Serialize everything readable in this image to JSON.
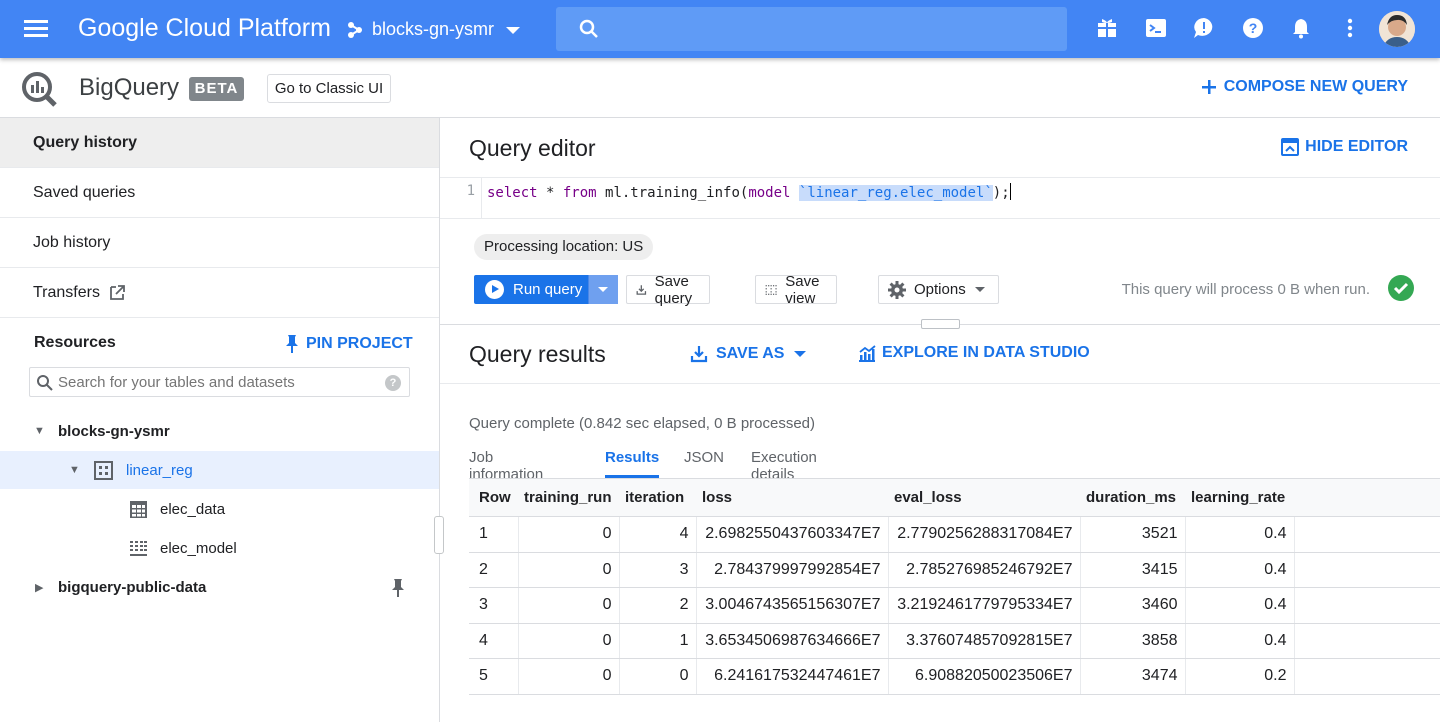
{
  "header": {
    "brand": "Google Cloud Platform",
    "project": "blocks-gn-ysmr",
    "search_placeholder": "",
    "icons": [
      "gift-icon",
      "terminal-icon",
      "feedback-icon",
      "help-icon",
      "notifications-icon",
      "more-vert-icon"
    ],
    "accent_color": "#4285f4"
  },
  "product": {
    "title": "BigQuery",
    "badge": "BETA",
    "classic_button": "Go to Classic UI",
    "compose": "COMPOSE NEW QUERY"
  },
  "sidebar": {
    "nav": [
      {
        "label": "Query history"
      },
      {
        "label": "Saved queries"
      },
      {
        "label": "Job history"
      },
      {
        "label": "Transfers"
      }
    ],
    "resources_label": "Resources",
    "pin_project": "PIN PROJECT",
    "search_placeholder": "Search for your tables and datasets",
    "tree": {
      "project": "blocks-gn-ysmr",
      "dataset": "linear_reg",
      "table": "elec_data",
      "model": "elec_model",
      "public": "bigquery-public-data"
    }
  },
  "editor": {
    "title": "Query editor",
    "hide": "HIDE EDITOR",
    "line_number": "1",
    "code": {
      "kw1": "select",
      "p1": " * ",
      "kw2": "from",
      "p2": " ml.training_info(",
      "kw3": "model",
      "p3": " ",
      "hl": "`linear_reg.elec_model`",
      "p4": ");"
    },
    "location": "Processing location: US",
    "run": "Run query",
    "save_query": "Save query",
    "save_view": "Save view",
    "options": "Options",
    "estimate": "This query will process 0 B when run."
  },
  "results": {
    "title": "Query results",
    "save_as": "SAVE AS",
    "explore": "EXPLORE IN DATA STUDIO",
    "status": "Query complete (0.842 sec elapsed, 0 B processed)",
    "tabs": [
      "Job information",
      "Results",
      "JSON",
      "Execution details"
    ],
    "columns": [
      "Row",
      "training_run",
      "iteration",
      "loss",
      "eval_loss",
      "duration_ms",
      "learning_rate"
    ],
    "rows": [
      [
        "1",
        "0",
        "4",
        "2.6982550437603347E7",
        "2.7790256288317084E7",
        "3521",
        "0.4"
      ],
      [
        "2",
        "0",
        "3",
        "2.784379997992854E7",
        "2.785276985246792E7",
        "3415",
        "0.4"
      ],
      [
        "3",
        "0",
        "2",
        "3.0046743565156307E7",
        "3.2192461779795334E7",
        "3460",
        "0.4"
      ],
      [
        "4",
        "0",
        "1",
        "3.6534506987634666E7",
        "3.376074857092815E7",
        "3858",
        "0.4"
      ],
      [
        "5",
        "0",
        "0",
        "6.241617532447461E7",
        "6.90882050023506E7",
        "3474",
        "0.2"
      ]
    ]
  }
}
